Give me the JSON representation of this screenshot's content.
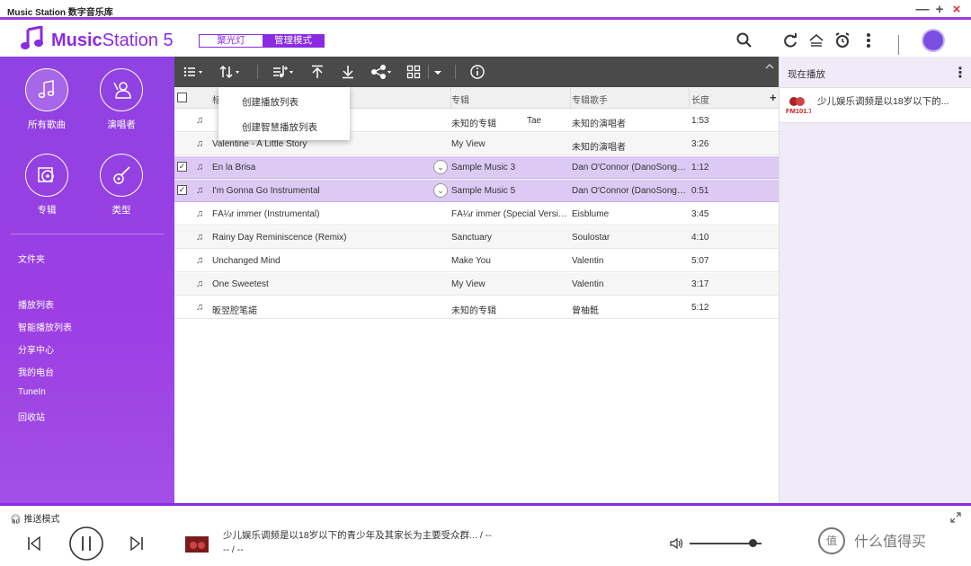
{
  "window": {
    "title": "Music Station 数字音乐库",
    "min_glyph": "—",
    "max_glyph": "+",
    "close_glyph": "×"
  },
  "header": {
    "logo_bold": "Music",
    "logo_rest": "Station 5",
    "mode_spotlight": "聚光灯",
    "mode_manage": "管理模式",
    "accent": "#8a2be2"
  },
  "sidebar": {
    "categories": [
      {
        "label": "所有歌曲",
        "icon": "music-note-icon",
        "active": true
      },
      {
        "label": "演唱者",
        "icon": "singer-icon"
      },
      {
        "label": "专辑",
        "icon": "album-icon"
      },
      {
        "label": "类型",
        "icon": "guitar-icon"
      }
    ],
    "folder": "文件夹",
    "links": [
      "播放列表",
      "智能播放列表",
      "分享中心",
      "我的电台",
      "TuneIn",
      "回收站"
    ]
  },
  "menu": {
    "items": [
      "创建播放列表",
      "创建智慧播放列表"
    ]
  },
  "table": {
    "headers": {
      "title": "标",
      "album": "专辑",
      "album_artist": "专辑歌手",
      "length": "长度",
      "add": "+"
    },
    "rows": [
      {
        "title": "Tae",
        "album": "未知的专辑",
        "artist": "未知的演唱者",
        "length": "1:53",
        "checked": false,
        "selected": false
      },
      {
        "title": "Valentine - A Little Story",
        "album": "My View",
        "artist": "未知的演唱者",
        "length": "3:26",
        "checked": false,
        "selected": false
      },
      {
        "title": "En la Brisa",
        "album": "Sample Music 3",
        "artist": "Dan O'Connor (DanoSongs....",
        "length": "1:12",
        "checked": true,
        "selected": true
      },
      {
        "title": "I'm Gonna Go Instrumental",
        "album": "Sample Music 5",
        "artist": "Dan O'Connor (DanoSongs....",
        "length": "0:51",
        "checked": true,
        "selected": true
      },
      {
        "title": "FÃ¼r immer (Instrumental)",
        "album": "FÃ¼r immer (Special Versio...",
        "artist": "Eisblume",
        "length": "3:45",
        "checked": false,
        "selected": false
      },
      {
        "title": "Rainy Day Reminiscence (Remix)",
        "album": "Sanctuary",
        "artist": "Soulostar",
        "length": "4:10",
        "checked": false,
        "selected": false
      },
      {
        "title": "Unchanged Mind",
        "album": "Make You",
        "artist": "Valentin",
        "length": "5:07",
        "checked": false,
        "selected": false
      },
      {
        "title": "One Sweetest",
        "album": "My View",
        "artist": "Valentin",
        "length": "3:17",
        "checked": false,
        "selected": false
      },
      {
        "title": "昄翌腔笔諾",
        "album": "未知的专辑",
        "artist": "曾柚骶",
        "length": "5:12",
        "checked": false,
        "selected": false
      }
    ]
  },
  "now_playing": {
    "title": "现在播放",
    "item": "少儿娱乐调频是以18岁以下的...",
    "thumb_text": "FM101.7"
  },
  "player": {
    "push_mode": "推送模式",
    "title": "少儿娱乐调频是以18岁以下的青少年及其家长为主要受众群... / --",
    "sub": "-- / --",
    "volume": 0.88,
    "watermark": "什么值得买",
    "watermark_icon": "值"
  }
}
